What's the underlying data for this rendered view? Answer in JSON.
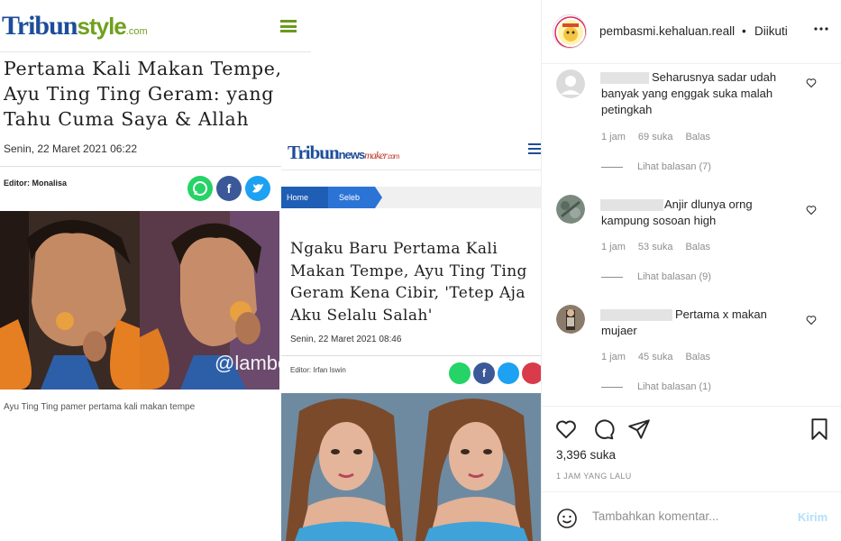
{
  "post": {
    "left_article": {
      "logo_tribun": "Tribun",
      "logo_style": "style",
      "logo_domain": ".com",
      "title": "Pertama Kali Makan Tempe, Ayu Ting Ting Geram: yang Tahu Cuma Saya & Allah",
      "date": "Senin, 22 Maret 2021 06:22",
      "editor": "Editor: Monalisa",
      "caption": "Ayu Ting Ting pamer pertama kali makan tempe",
      "watermark": "@lambegosiip"
    },
    "right_article": {
      "logo_tribun": "Tribun",
      "logo_news": "news",
      "logo_maker": "maker",
      "logo_domain": ".com",
      "breadcrumb_home": "Home",
      "breadcrumb_section": "Seleb",
      "title": "Ngaku Baru Pertama Kali Makan Tempe, Ayu Ting Ting Geram Kena Cibir, 'Tetep Aja Aku Selalu Salah'",
      "date": "Senin, 22 Maret 2021 08:46",
      "editor": "Editor: Irfan Iswin"
    }
  },
  "panel": {
    "username": "pembasmi.kehaluan.reall",
    "separator": "•",
    "following_label": "Diikuti",
    "more_icon": "ellipsis-icon",
    "comments": [
      {
        "text": "Seharusnya sadar udah banyak yang enggak suka malah petingkah",
        "time": "1 jam",
        "likes": "69 suka",
        "reply": "Balas",
        "view_replies": "Lihat balasan (7)"
      },
      {
        "text": "Anjir dlunya orng kampung sosoan high",
        "time": "1 jam",
        "likes": "53 suka",
        "reply": "Balas",
        "view_replies": "Lihat balasan (9)"
      },
      {
        "text": "Pertama x makan mujaer",
        "time": "1 jam",
        "likes": "45 suka",
        "reply": "Balas",
        "view_replies": "Lihat balasan (1)"
      }
    ],
    "likes_count": "3,396 suka",
    "posted_time": "1 JAM YANG LALU",
    "comment_placeholder": "Tambahkan komentar...",
    "send_label": "Kirim"
  }
}
